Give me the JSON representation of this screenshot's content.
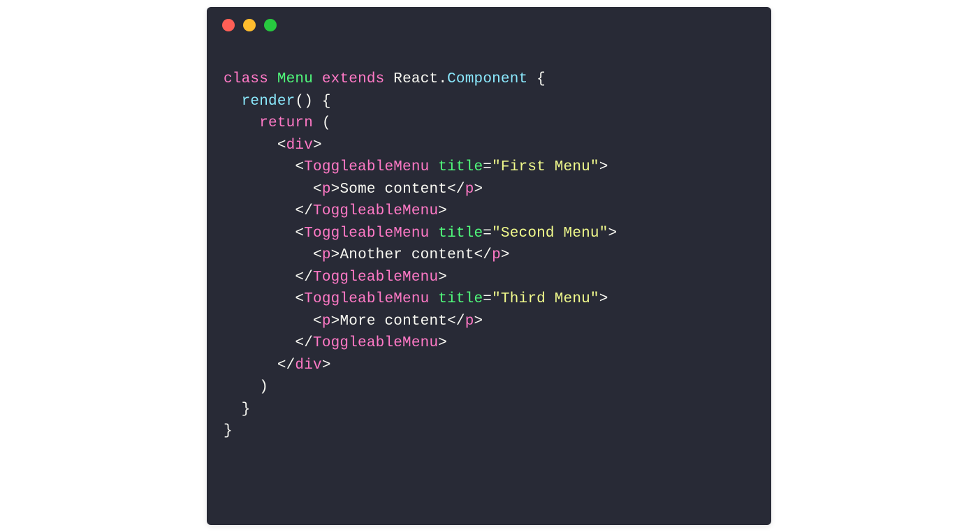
{
  "code": {
    "class_kw": "class",
    "class_name": "Menu",
    "extends_kw": "extends",
    "react_obj": "React",
    "dot": ".",
    "component": "Component",
    "open_brace": " {",
    "render_fn": "render",
    "render_parens": "() {",
    "return_kw": "return",
    "return_paren": " (",
    "div_open_a": "<",
    "div_tag": "div",
    "div_open_b": ">",
    "tm_open_a": "<",
    "tm_tag": "ToggleableMenu",
    "title_attr": "title",
    "eq": "=",
    "title1": "\"First Menu\"",
    "title2": "\"Second Menu\"",
    "title3": "\"Third Menu\"",
    "close_angle": ">",
    "p_open_a": "<",
    "p_tag": "p",
    "p_open_b": ">",
    "content1": "Some content",
    "content2": "Another content",
    "content3": "More content",
    "p_close_a": "</",
    "p_close_b": ">",
    "tm_close_a": "</",
    "tm_close_b": ">",
    "div_close_a": "</",
    "div_close_b": ">",
    "close_paren": ")",
    "close_brace1": "}",
    "close_brace2": "}"
  }
}
